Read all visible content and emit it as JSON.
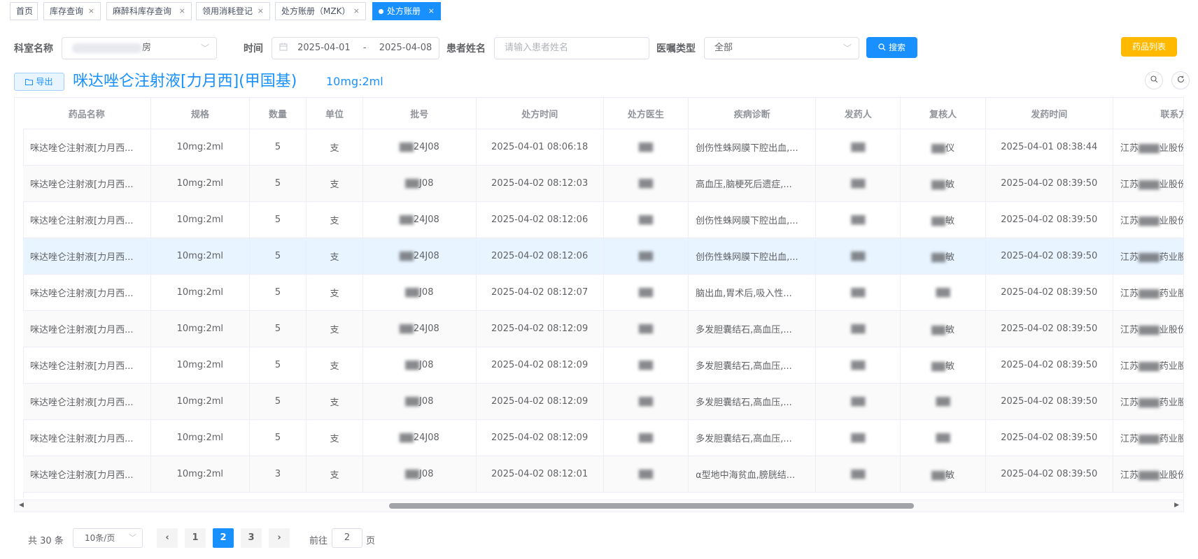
{
  "tabs": [
    {
      "label": "首页",
      "closable": false,
      "active": false
    },
    {
      "label": "库存查询",
      "closable": true,
      "active": false
    },
    {
      "label": "麻醉科库存查询",
      "closable": true,
      "active": false
    },
    {
      "label": "领用消耗登记",
      "closable": true,
      "active": false
    },
    {
      "label": "处方账册（MZK）",
      "closable": true,
      "active": false
    },
    {
      "label": "处方账册",
      "closable": true,
      "active": true
    }
  ],
  "filters": {
    "dept_label": "科室名称",
    "dept_value_suffix": "房",
    "time_label": "时间",
    "date_start": "2025-04-01",
    "date_sep": "-",
    "date_end": "2025-04-08",
    "patient_label": "患者姓名",
    "patient_placeholder": "请输入患者姓名",
    "order_type_label": "医嘱类型",
    "order_type_value": "全部",
    "search_label": "搜索",
    "drug_list_label": "药品列表"
  },
  "toolbar": {
    "export_label": "导出",
    "drug_title": "咪达唑仑注射液[力月西](甲国基)",
    "drug_spec": "10mg:2ml"
  },
  "table": {
    "columns": [
      "药品名称",
      "规格",
      "数量",
      "单位",
      "批号",
      "处方时间",
      "处方医生",
      "疾病诊断",
      "发药人",
      "复核人",
      "发药时间",
      "联系方式"
    ],
    "rows": [
      {
        "name": "咪达唑仑注射液[力月西...",
        "spec": "10mg:2ml",
        "qty": "5",
        "unit": "支",
        "batch": "24J08",
        "rx_time": "2025-04-01 08:06:18",
        "doctor": "",
        "diagnosis": "创伤性蛛网膜下腔出血,...",
        "dispenser": "",
        "reviewer": "仪",
        "dispense_time": "2025-04-01 08:38:44",
        "contact_pre": "江苏",
        "contact_post": "业股份"
      },
      {
        "name": "咪达唑仑注射液[力月西...",
        "spec": "10mg:2ml",
        "qty": "5",
        "unit": "支",
        "batch": "J08",
        "rx_time": "2025-04-02 08:12:03",
        "doctor": "",
        "diagnosis": "高血压,脑梗死后遗症,...",
        "dispenser": "",
        "reviewer": "敏",
        "dispense_time": "2025-04-02 08:39:50",
        "contact_pre": "江苏",
        "contact_post": "业股份"
      },
      {
        "name": "咪达唑仑注射液[力月西...",
        "spec": "10mg:2ml",
        "qty": "5",
        "unit": "支",
        "batch": "24J08",
        "rx_time": "2025-04-02 08:12:06",
        "doctor": "",
        "diagnosis": "创伤性蛛网膜下腔出血,...",
        "dispenser": "",
        "reviewer": "敏",
        "dispense_time": "2025-04-02 08:39:50",
        "contact_pre": "江苏",
        "contact_post": "业股份"
      },
      {
        "name": "咪达唑仑注射液[力月西...",
        "spec": "10mg:2ml",
        "qty": "5",
        "unit": "支",
        "batch": "24J08",
        "rx_time": "2025-04-02 08:12:06",
        "doctor": "",
        "diagnosis": "创伤性蛛网膜下腔出血,...",
        "dispenser": "",
        "reviewer": "敏",
        "dispense_time": "2025-04-02 08:39:50",
        "contact_pre": "江苏",
        "contact_post": "药业股份"
      },
      {
        "name": "咪达唑仑注射液[力月西...",
        "spec": "10mg:2ml",
        "qty": "5",
        "unit": "支",
        "batch": "J08",
        "rx_time": "2025-04-02 08:12:07",
        "doctor": "",
        "diagnosis": "脑出血,胃术后,吸入性...",
        "dispenser": "",
        "reviewer": "",
        "dispense_time": "2025-04-02 08:39:50",
        "contact_pre": "江苏",
        "contact_post": "药业股份"
      },
      {
        "name": "咪达唑仑注射液[力月西...",
        "spec": "10mg:2ml",
        "qty": "5",
        "unit": "支",
        "batch": "24J08",
        "rx_time": "2025-04-02 08:12:09",
        "doctor": "",
        "diagnosis": "多发胆囊结石,高血压,...",
        "dispenser": "",
        "reviewer": "敏",
        "dispense_time": "2025-04-02 08:39:50",
        "contact_pre": "江苏",
        "contact_post": "业股份"
      },
      {
        "name": "咪达唑仑注射液[力月西...",
        "spec": "10mg:2ml",
        "qty": "5",
        "unit": "支",
        "batch": "J08",
        "rx_time": "2025-04-02 08:12:09",
        "doctor": "",
        "diagnosis": "多发胆囊结石,高血压,...",
        "dispenser": "",
        "reviewer": "敏",
        "dispense_time": "2025-04-02 08:39:50",
        "contact_pre": "江苏",
        "contact_post": "药业股份"
      },
      {
        "name": "咪达唑仑注射液[力月西...",
        "spec": "10mg:2ml",
        "qty": "5",
        "unit": "支",
        "batch": "J08",
        "rx_time": "2025-04-02 08:12:09",
        "doctor": "",
        "diagnosis": "多发胆囊结石,高血压,...",
        "dispenser": "",
        "reviewer": "",
        "dispense_time": "2025-04-02 08:39:50",
        "contact_pre": "江苏",
        "contact_post": "药业股份"
      },
      {
        "name": "咪达唑仑注射液[力月西...",
        "spec": "10mg:2ml",
        "qty": "5",
        "unit": "支",
        "batch": "24J08",
        "rx_time": "2025-04-02 08:12:09",
        "doctor": "",
        "diagnosis": "多发胆囊结石,高血压,...",
        "dispenser": "",
        "reviewer": "",
        "dispense_time": "2025-04-02 08:39:50",
        "contact_pre": "江苏",
        "contact_post": "药业股份"
      },
      {
        "name": "咪达唑仑注射液[力月西...",
        "spec": "10mg:2ml",
        "qty": "3",
        "unit": "支",
        "batch": "J08",
        "rx_time": "2025-04-02 08:12:01",
        "doctor": "",
        "diagnosis": "α型地中海贫血,膀胱结...",
        "dispenser": "",
        "reviewer": "敏",
        "dispense_time": "2025-04-02 08:39:50",
        "contact_pre": "江苏",
        "contact_post": "业股份"
      }
    ]
  },
  "pagination": {
    "total_text": "共 30 条",
    "page_size": "10条/页",
    "prev": "‹",
    "next": "›",
    "pages": [
      "1",
      "2",
      "3"
    ],
    "current_page": "2",
    "goto_label": "前往",
    "goto_value": "2",
    "goto_unit": "页"
  },
  "colors": {
    "primary": "#1890ff",
    "warning": "#ffba00",
    "selected_row": "#e8f4ff"
  }
}
